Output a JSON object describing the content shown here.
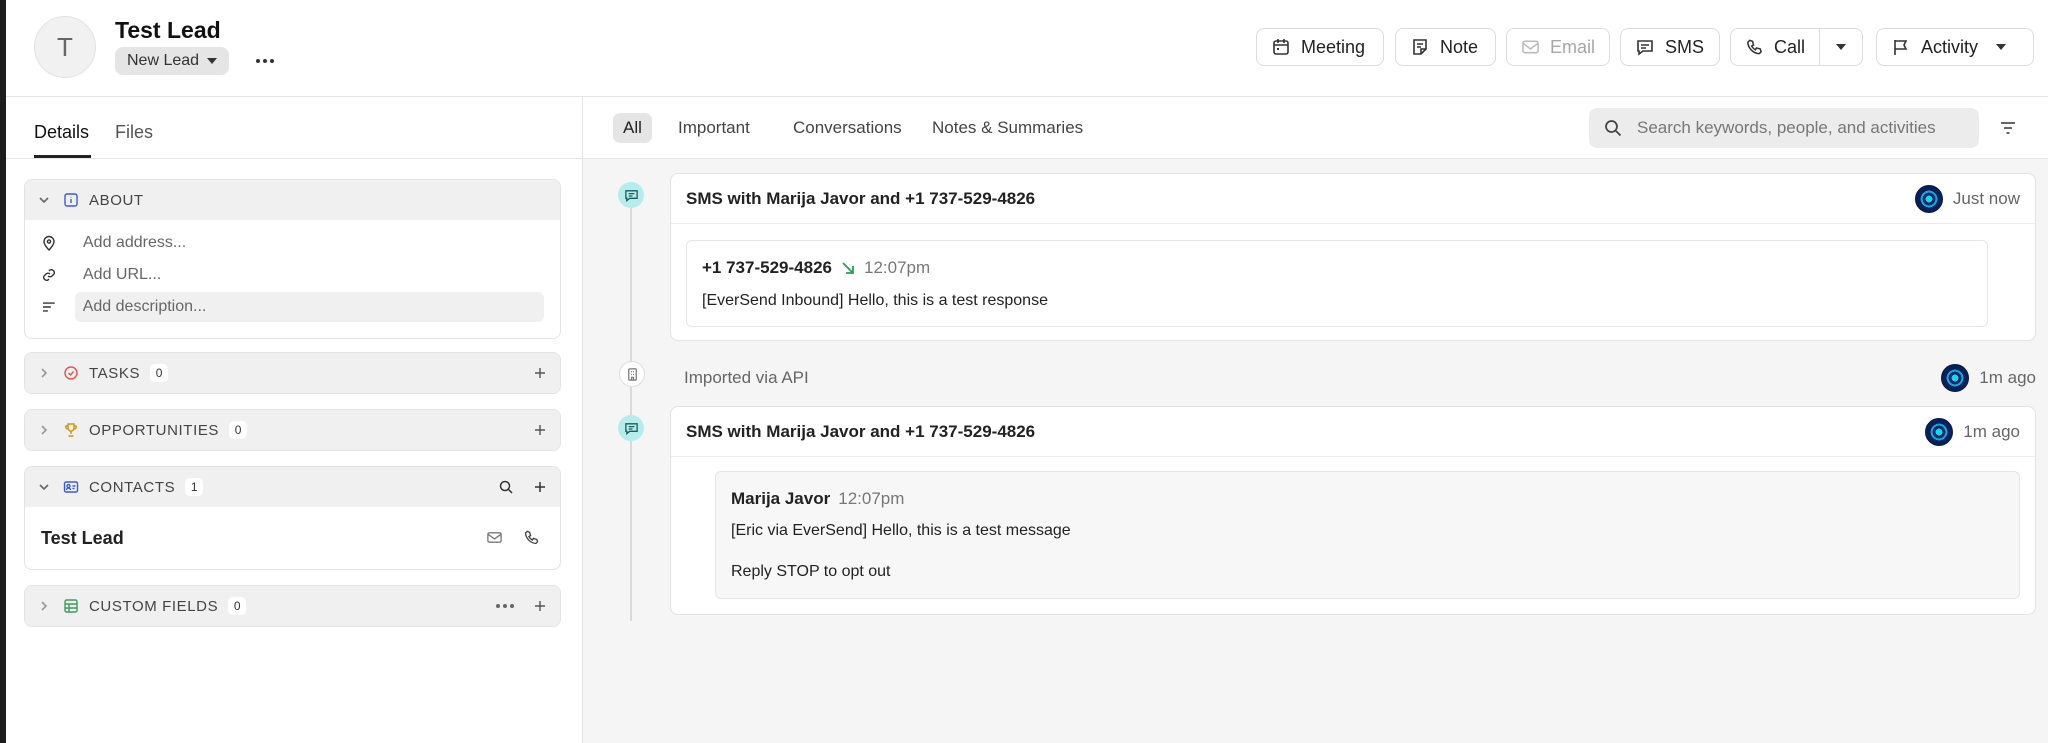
{
  "lead": {
    "avatar_initial": "T",
    "name": "Test Lead",
    "status": "New Lead"
  },
  "header_actions": [
    {
      "label": "Meeting",
      "icon": "calendar-icon"
    },
    {
      "label": "Note",
      "icon": "note-icon"
    },
    {
      "label": "Email",
      "icon": "mail-icon",
      "disabled": true
    },
    {
      "label": "SMS",
      "icon": "message-icon"
    },
    {
      "label": "Call",
      "icon": "phone-icon"
    },
    {
      "label": "Activity",
      "icon": "flag-icon"
    }
  ],
  "left_tabs": {
    "details": "Details",
    "files": "Files"
  },
  "sections": {
    "about": {
      "title": "ABOUT",
      "address_placeholder": "Add address...",
      "url_placeholder": "Add URL...",
      "description_placeholder": "Add description..."
    },
    "tasks": {
      "title": "TASKS",
      "count": "0"
    },
    "opportunities": {
      "title": "OPPORTUNITIES",
      "count": "0"
    },
    "contacts": {
      "title": "CONTACTS",
      "count": "1",
      "items": [
        {
          "name": "Test Lead"
        }
      ]
    },
    "custom_fields": {
      "title": "CUSTOM FIELDS",
      "count": "0"
    }
  },
  "feed_tabs": {
    "all": "All",
    "important": "Important",
    "conversations": "Conversations",
    "notes": "Notes & Summaries"
  },
  "search": {
    "placeholder": "Search keywords, people, and activities"
  },
  "activities": {
    "sms1": {
      "title": "SMS with Marija Javor and +1 737-529-4826",
      "time_ago": "Just now",
      "sender": "+1 737-529-4826",
      "time": "12:07pm",
      "text": "[EverSend Inbound] Hello, this is a test response"
    },
    "import": {
      "text": "Imported via API",
      "time_ago": "1m ago"
    },
    "sms2": {
      "title": "SMS with Marija Javor and +1 737-529-4826",
      "time_ago": "1m ago",
      "sender": "Marija Javor",
      "time": "12:07pm",
      "text": "[Eric via EverSend] Hello, this is a test message",
      "text2": "Reply STOP to opt out"
    }
  },
  "colors": {
    "accent_teal": "#b7ecec",
    "inbound_arrow": "#2e9e4f"
  }
}
